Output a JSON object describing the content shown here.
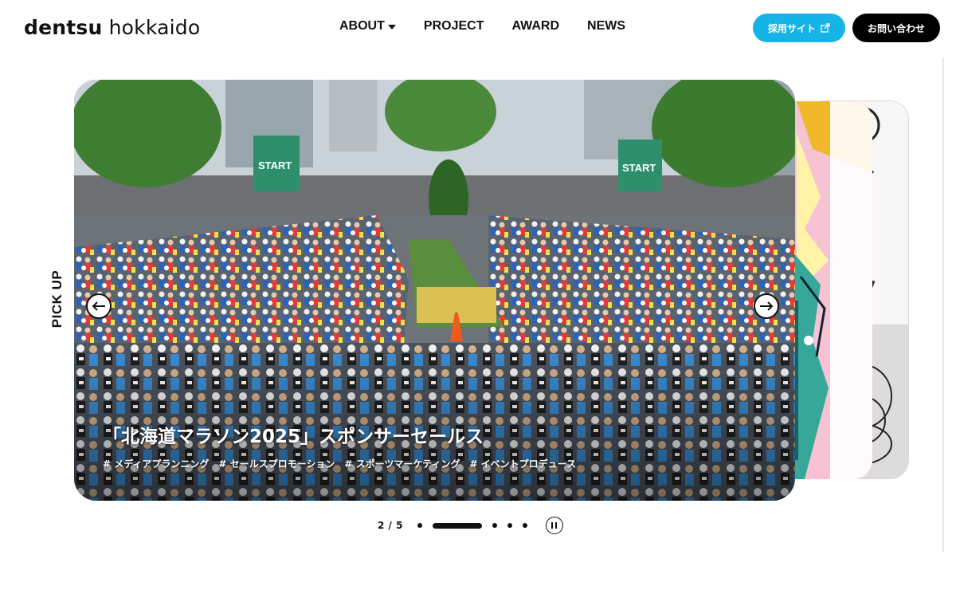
{
  "header": {
    "logo_bold": "dentsu",
    "logo_light": "hokkaido",
    "nav": [
      {
        "label": "ABOUT",
        "has_dropdown": true
      },
      {
        "label": "PROJECT"
      },
      {
        "label": "AWARD"
      },
      {
        "label": "NEWS"
      }
    ],
    "recruit_label": "採用サイト",
    "contact_label": "お問い合わせ"
  },
  "pickup_label": "PICK UP",
  "slide": {
    "title": "「北海道マラソン2025」スポンサーセールス",
    "tags": [
      "# メディアプランニング",
      "# セールスプロモーション",
      "# スポーツマーケティング",
      "# イベントプロデュース"
    ],
    "banner_text": "START"
  },
  "pager": {
    "current_text": "2 / 5",
    "total": 5,
    "active_index": 0
  },
  "colors": {
    "recruit_button": "#16b4e6",
    "contact_button": "#000000"
  }
}
